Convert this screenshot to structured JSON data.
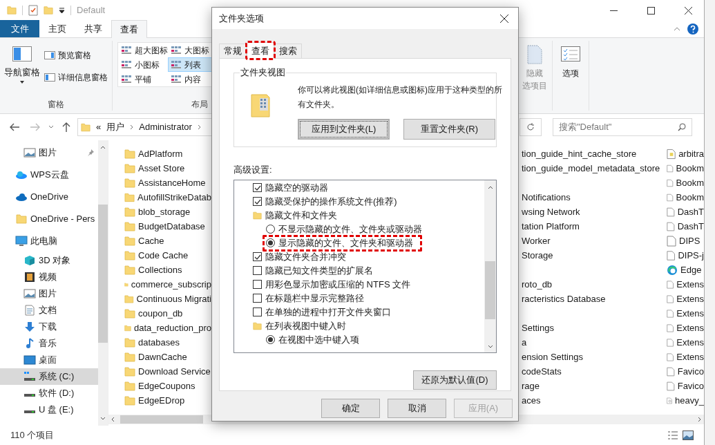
{
  "explorer": {
    "title": "Default",
    "ribbon_tabs": [
      {
        "label": "文件",
        "kind": "menu",
        "selected": false
      },
      {
        "label": "主页",
        "kind": "tab",
        "selected": false
      },
      {
        "label": "共享",
        "kind": "tab",
        "selected": false
      },
      {
        "label": "查看",
        "kind": "tab",
        "selected": true
      }
    ],
    "ribbon": {
      "pane_group": {
        "label": "窗格",
        "nav_pane": "导航窗格",
        "buttons": [
          "预览窗格",
          "详细信息窗格"
        ]
      },
      "layout_group": {
        "label": "布局",
        "items": [
          {
            "label": "超大图标",
            "selected": false
          },
          {
            "label": "大图标",
            "selected": false
          },
          {
            "label": "小图标",
            "selected": false
          },
          {
            "label": "列表",
            "selected": true
          },
          {
            "label": "平铺",
            "selected": false
          },
          {
            "label": "内容",
            "selected": false
          }
        ]
      },
      "hide_button": {
        "label": "隐藏",
        "sublabel": "选项目",
        "disabled": true
      },
      "options_button": "选项"
    },
    "address": {
      "overflow": "«",
      "crumbs": [
        "用户",
        "Administrator"
      ]
    },
    "search": {
      "placeholder": "搜索\"Default\""
    },
    "sidebar": [
      {
        "label": "图片",
        "kind": "pictures",
        "pinned": true,
        "selected": false
      },
      {
        "label": "WPS云盘",
        "kind": "wps",
        "pinned": false,
        "selected": false
      },
      {
        "label": "OneDrive",
        "kind": "cloud",
        "pinned": false,
        "selected": false
      },
      {
        "label": "OneDrive - Pers",
        "kind": "folder",
        "pinned": false,
        "selected": false
      },
      {
        "label": "此电脑",
        "kind": "pc",
        "pinned": false,
        "selected": false,
        "children": [
          {
            "label": "3D 对象",
            "kind": "cube",
            "selected": false
          },
          {
            "label": "视频",
            "kind": "video",
            "selected": false
          },
          {
            "label": "图片",
            "kind": "pictures",
            "selected": false
          },
          {
            "label": "文档",
            "kind": "document",
            "selected": false
          },
          {
            "label": "下载",
            "kind": "download",
            "selected": false
          },
          {
            "label": "音乐",
            "kind": "music",
            "selected": false
          },
          {
            "label": "桌面",
            "kind": "desktop",
            "selected": false
          },
          {
            "label": "系统 (C:)",
            "kind": "system-drive",
            "selected": true
          },
          {
            "label": "软件 (D:)",
            "kind": "drive",
            "selected": false
          },
          {
            "label": "U 盘 (E:)",
            "kind": "drive",
            "selected": false
          }
        ]
      }
    ],
    "file_columns": [
      [
        {
          "name": "AdPlatform",
          "kind": "folder"
        },
        {
          "name": "Asset Store",
          "kind": "folder"
        },
        {
          "name": "AssistanceHome",
          "kind": "folder"
        },
        {
          "name": "AutofillStrikeDatab",
          "kind": "folder"
        },
        {
          "name": "blob_storage",
          "kind": "folder"
        },
        {
          "name": "BudgetDatabase",
          "kind": "folder"
        },
        {
          "name": "Cache",
          "kind": "folder"
        },
        {
          "name": "Code Cache",
          "kind": "folder"
        },
        {
          "name": "Collections",
          "kind": "folder"
        },
        {
          "name": "commerce_subscrip",
          "kind": "folder"
        },
        {
          "name": "Continuous Migrati",
          "kind": "folder"
        },
        {
          "name": "coupon_db",
          "kind": "folder"
        },
        {
          "name": "data_reduction_pro",
          "kind": "folder"
        },
        {
          "name": "databases",
          "kind": "folder"
        },
        {
          "name": "DawnCache",
          "kind": "folder"
        },
        {
          "name": "Download Service",
          "kind": "folder"
        },
        {
          "name": "EdgeCoupons",
          "kind": "folder"
        },
        {
          "name": "EdgeEDrop",
          "kind": "folder"
        }
      ],
      [
        {
          "name": "tion_guide_hint_cache_store",
          "kind": "fragment"
        },
        {
          "name": "tion_guide_model_metadata_store",
          "kind": "fragment"
        },
        {
          "kind": "covered"
        },
        {
          "name": "Notifications",
          "kind": "fragment"
        },
        {
          "name": "wsing Network",
          "kind": "fragment"
        },
        {
          "name": "tation Platform",
          "kind": "fragment"
        },
        {
          "name": "Worker",
          "kind": "fragment"
        },
        {
          "name": "Storage",
          "kind": "fragment"
        },
        {
          "kind": "covered"
        },
        {
          "name": "roto_db",
          "kind": "fragment"
        },
        {
          "name": "racteristics Database",
          "kind": "fragment"
        },
        {
          "kind": "covered"
        },
        {
          "name": "Settings",
          "kind": "fragment"
        },
        {
          "name": "a",
          "kind": "fragment"
        },
        {
          "name": "ension Settings",
          "kind": "fragment"
        },
        {
          "name": "codeStats",
          "kind": "fragment"
        },
        {
          "name": "rage",
          "kind": "fragment"
        },
        {
          "name": "aces",
          "kind": "fragment"
        }
      ],
      [
        {
          "name": "arbitra",
          "kind": "data-file"
        },
        {
          "name": "Bookm",
          "kind": "file"
        },
        {
          "name": "Bookm",
          "kind": "file"
        },
        {
          "name": "Bookm",
          "kind": "file"
        },
        {
          "name": "DashT",
          "kind": "file"
        },
        {
          "name": "DashT",
          "kind": "file"
        },
        {
          "name": "DIPS",
          "kind": "file"
        },
        {
          "name": "DIPS-j",
          "kind": "file"
        },
        {
          "name": "Edge",
          "kind": "edge"
        },
        {
          "name": "Extens",
          "kind": "file"
        },
        {
          "name": "Extens",
          "kind": "file"
        },
        {
          "name": "Extens",
          "kind": "file"
        },
        {
          "name": "Extens",
          "kind": "file"
        },
        {
          "name": "Extens",
          "kind": "file"
        },
        {
          "name": "Extens",
          "kind": "file"
        },
        {
          "name": "Favico",
          "kind": "file"
        },
        {
          "name": "Favico",
          "kind": "file"
        },
        {
          "name": "heavy_",
          "kind": "settings-file"
        }
      ]
    ],
    "status": "110 个项目"
  },
  "dialog": {
    "title": "文件夹选项",
    "tabs": [
      {
        "label": "常规",
        "selected": false,
        "highlighted": false
      },
      {
        "label": "查看",
        "selected": true,
        "highlighted": true
      },
      {
        "label": "搜索",
        "selected": false,
        "highlighted": false
      }
    ],
    "folder_views": {
      "legend": "文件夹视图",
      "text": "你可以将此视图(如详细信息或图标)应用于这种类型的所有文件夹。",
      "buttons": [
        {
          "label": "应用到文件夹(L)",
          "focused": true
        },
        {
          "label": "重置文件夹(R)",
          "focused": false
        }
      ]
    },
    "advanced_label": "高级设置:",
    "advanced": [
      {
        "kind": "checkbox",
        "label": "隐藏空的驱动器",
        "checked": true,
        "highlighted": false
      },
      {
        "kind": "checkbox",
        "label": "隐藏受保护的操作系统文件(推荐)",
        "checked": true,
        "highlighted": false
      },
      {
        "kind": "folder",
        "label": "隐藏文件和文件夹",
        "highlighted": false,
        "children": [
          {
            "kind": "radio",
            "label": "不显示隐藏的文件、文件夹或驱动器",
            "selected": false,
            "highlighted": false
          },
          {
            "kind": "radio",
            "label": "显示隐藏的文件、文件夹和驱动器",
            "selected": true,
            "highlighted": true
          }
        ]
      },
      {
        "kind": "checkbox",
        "label": "隐藏文件夹合并冲突",
        "checked": true,
        "highlighted": false
      },
      {
        "kind": "checkbox",
        "label": "隐藏已知文件类型的扩展名",
        "checked": false,
        "highlighted": false
      },
      {
        "kind": "checkbox",
        "label": "用彩色显示加密或压缩的 NTFS 文件",
        "checked": false,
        "highlighted": false
      },
      {
        "kind": "checkbox",
        "label": "在标题栏中显示完整路径",
        "checked": false,
        "highlighted": false
      },
      {
        "kind": "checkbox",
        "label": "在单独的进程中打开文件夹窗口",
        "checked": false,
        "highlighted": false
      },
      {
        "kind": "folder",
        "label": "在列表视图中键入时",
        "highlighted": false,
        "children": [
          {
            "kind": "radio",
            "label": "在视图中选中键入项",
            "selected": true,
            "highlighted": false
          }
        ]
      }
    ],
    "restore_button": "还原为默认值(D)",
    "buttons": [
      {
        "label": "确定",
        "disabled": false
      },
      {
        "label": "取消",
        "disabled": false
      },
      {
        "label": "应用(A)",
        "disabled": true
      }
    ]
  }
}
